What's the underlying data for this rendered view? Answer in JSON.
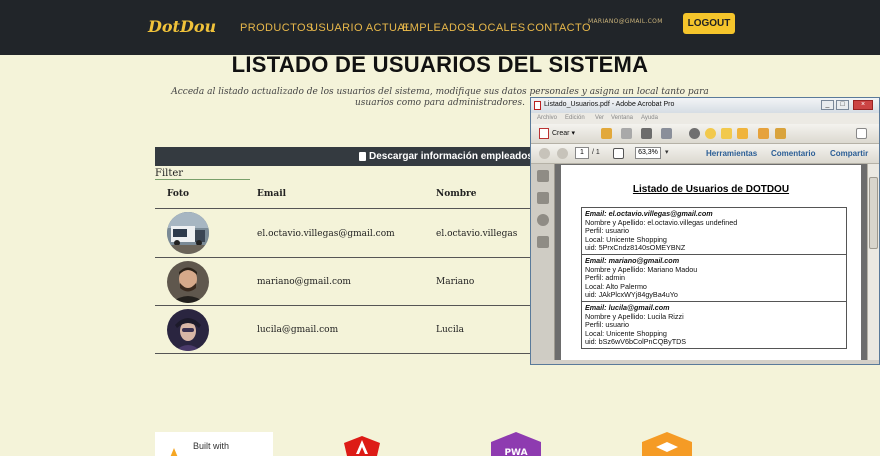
{
  "nav": {
    "brand": "DotDou",
    "links": [
      "PRODUCTOS",
      "USUARIO ACTUAL",
      "EMPLEADOS",
      "LOCALES",
      "CONTACTO"
    ],
    "user_email": "MARIANO@GMAIL.COM",
    "logout": "LOGOUT"
  },
  "page": {
    "title": "LISTADO DE USUARIOS DEL SISTEMA",
    "subtitle": "Acceda al listado actualizado de los usuarios del sistema, modifique sus datos personales y asigna un local tanto para usuarios como para administradores."
  },
  "table": {
    "download_label": "Descargar información empleados",
    "filter_label": "Filter",
    "headers": [
      "Foto",
      "Email",
      "Nombre"
    ],
    "rows": [
      {
        "email": "el.octavio.villegas@gmail.com",
        "name": "el.octavio.villegas",
        "photo": "truck-photo"
      },
      {
        "email": "mariano@gmail.com",
        "name": "Mariano",
        "photo": "man-photo"
      },
      {
        "email": "lucila@gmail.com",
        "name": "Lucila",
        "photo": "woman-photo"
      }
    ]
  },
  "footer": {
    "built_with": "Built with"
  },
  "acrobat": {
    "window_title": "Listado_Usuarios.pdf - Adobe Acrobat Pro",
    "menu": [
      "Archivo",
      "Edición",
      "Ver",
      "Ventana",
      "Ayuda"
    ],
    "create_label": "Crear",
    "page_current": "1",
    "page_total": "/ 1",
    "zoom": "63,3%",
    "links": [
      "Herramientas",
      "Comentario",
      "Compartir"
    ],
    "doc_title": "Listado de Usuarios de DOTDOU",
    "records": [
      {
        "email": "Email: el.octavio.villegas@gmail.com",
        "name": "Nombre y Apellido: el.octavio.villegas undefined",
        "profile": "Perfil: usuario",
        "local": "Local: Unicente Shopping",
        "uid": "uid: 5PrxCndz8140sOMEYBNZ"
      },
      {
        "email": "Email: mariano@gmail.com",
        "name": "Nombre y Apellido: Mariano Madou",
        "profile": "Perfil: admin",
        "local": "Local: Alto Palermo",
        "uid": "uid: JAkPlcxWYj84gyBa4uYo"
      },
      {
        "email": "Email: lucila@gmail.com",
        "name": "Nombre y Apellido: Lucila Rizzi",
        "profile": "Perfil: usuario",
        "local": "Local: Unicente Shopping",
        "uid": "uid: bSz6wV6bColPnCQByTDS"
      }
    ]
  },
  "colors": {
    "nav_bg": "#212529",
    "accent": "#f5c52b",
    "page_bg": "#f4f3d9",
    "dark_bar": "#343a40",
    "acrobat_link": "#2b5e96"
  }
}
